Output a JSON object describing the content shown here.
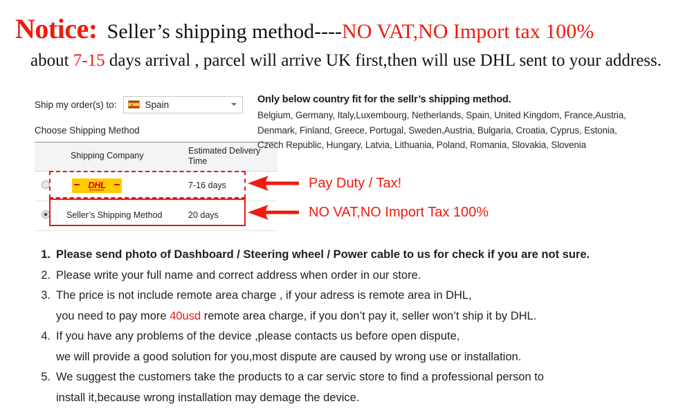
{
  "header": {
    "notice_word": "Notice:",
    "notice_rest": "Seller’s  shipping method----",
    "notice_red": "NO VAT,NO Import tax 100%",
    "about_prefix": "about ",
    "about_days": "7-15",
    "about_suffix": " days arrival , parcel will arrive UK first,then will use DHL sent to your address."
  },
  "ship_widget": {
    "ship_to_label": "Ship my order(s) to:",
    "country_value": "Spain",
    "country_flag": "spain-flag",
    "choose_label": "Choose Shipping Method",
    "columns": [
      "",
      "Shipping Company",
      "Estimated Delivery Time"
    ],
    "rows": [
      {
        "selected": false,
        "company_logo": "dhl-logo",
        "company_logo_text": "DHL",
        "company_logo_sub": "EXPRESS",
        "company_name": "",
        "eta": "7-16 days",
        "highlight": "dashed"
      },
      {
        "selected": true,
        "company_logo": "",
        "company_logo_text": "",
        "company_logo_sub": "",
        "company_name": "Seller’s Shipping Method",
        "eta": "20 days",
        "highlight": "solid"
      }
    ]
  },
  "country_info": {
    "title": "Only below country fit for the sellr’s shipping method.",
    "lines": [
      "Belgium, Germany, Italy,Luxembourg, Netherlands, Spain, United Kingdom, France,Austria,",
      "Denmark, Finland, Greece, Portugal, Sweden,Austria, Bulgaria, Croatia, Cyprus, Estonia,",
      "Czech Republic, Hungary, Latvia, Lithuania, Poland, Romania, Slovakia, Slovenia"
    ]
  },
  "annotations": [
    {
      "icon": "left-arrow-icon",
      "text": "Pay Duty / Tax!"
    },
    {
      "icon": "left-arrow-icon",
      "text": "NO VAT,NO Import Tax 100%"
    }
  ],
  "notes": [
    {
      "num": "1.",
      "bold": true,
      "line1": "Please send photo of Dashboard / Steering wheel / Power cable to us for check if you are not sure.",
      "line2": ""
    },
    {
      "num": "2.",
      "bold": false,
      "line1": "Please write your full name and correct address when order in our store.",
      "line2": ""
    },
    {
      "num": "3.",
      "bold": false,
      "line1": "The price is not include remote area charge , if your adress is remote area in DHL,",
      "line2_pre": "you need to pay more ",
      "line2_red": "40usd",
      "line2_post": " remote area charge, if you don’t pay it, seller won’t ship it by DHL."
    },
    {
      "num": "4.",
      "bold": false,
      "line1": "If you have any problems of the device ,please contacts us before open dispute,",
      "line2": "we will provide a good solution for you,most dispute are caused by wrong use or installation."
    },
    {
      "num": "5.",
      "bold": false,
      "line1": "We suggest the customers take the products to a car servic store to find a professional person to",
      "line2": "install it,because wrong installation may demage the device."
    }
  ],
  "colors": {
    "red": "#ee1b0e",
    "dhl_yellow": "#ffcc00",
    "dhl_red": "#d40511",
    "text": "#1f1f1f"
  }
}
